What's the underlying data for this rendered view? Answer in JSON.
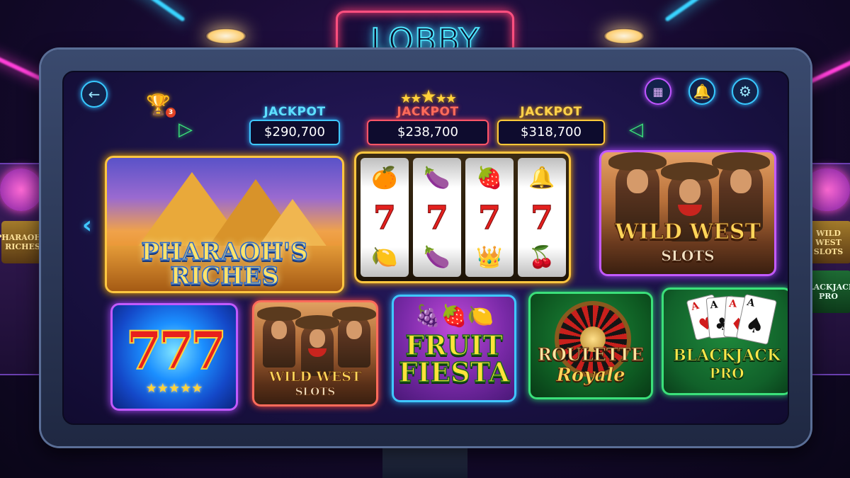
{
  "sign": {
    "text": "LOBBY"
  },
  "toolbar": {
    "back_icon": "arrow-left-icon",
    "trophy_icon": "trophy-icon",
    "trophy_badge": "3",
    "gallery_icon": "image-gallery-icon",
    "bell_icon": "bell-icon",
    "settings_icon": "gear-icon"
  },
  "jackpots": [
    {
      "label": "JACKPOT",
      "amount": "$290,700",
      "color": "#3fc7ff"
    },
    {
      "label": "JACKPOT",
      "amount": "$238,700",
      "color": "#ff5567"
    },
    {
      "label": "JACKPOT",
      "amount": "$318,700",
      "color": "#ffc93a"
    }
  ],
  "games": {
    "pharaoh": {
      "title_line1": "PHARAOH'S",
      "title_line2": "RICHES"
    },
    "reels": {
      "row1": [
        "orange",
        "plum",
        "raspberry",
        "bell"
      ],
      "row2": [
        "7",
        "7",
        "7",
        "7"
      ],
      "row3": [
        "lemon",
        "plum",
        "crown",
        "cherry"
      ]
    },
    "wildwest_big": {
      "title": "WILD WEST",
      "sub": "SLOTS"
    },
    "sevens": {
      "title": "777"
    },
    "wildwest_small": {
      "title": "WILD WEST",
      "sub": "SLOTS"
    },
    "fruit": {
      "title_line1": "FRUIT",
      "title_line2": "FIESTA"
    },
    "roulette": {
      "title": "ROULETTE",
      "sub": "Royale"
    },
    "blackjack": {
      "title": "BLACKJACK",
      "sub": "PRO",
      "cards": [
        "A",
        "A",
        "A",
        "A"
      ]
    }
  },
  "side_machines": {
    "left": {
      "card1": "PHARAOH'S RICHES"
    },
    "right": {
      "card1": "WILD WEST SLOTS",
      "card2": "BLACKJACK PRO"
    }
  },
  "colors": {
    "accent_cyan": "#3fc7ff",
    "accent_purple": "#c25aff",
    "accent_green": "#3be07a",
    "accent_gold": "#ffc640"
  }
}
